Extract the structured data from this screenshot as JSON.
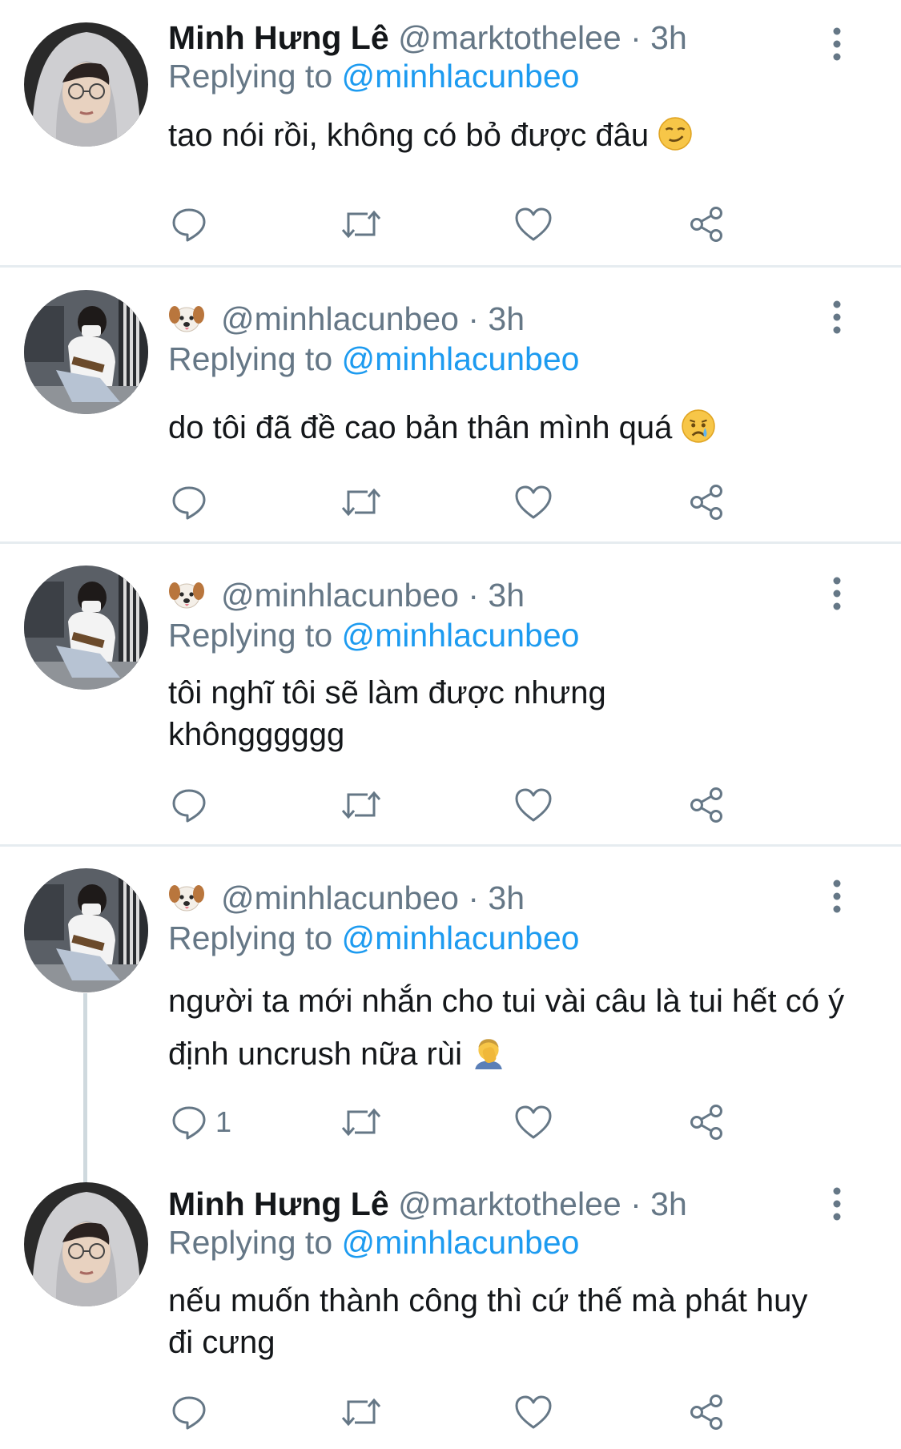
{
  "tweets": [
    {
      "display_name": "Minh Hưng Lê",
      "handle": "@marktothelee",
      "dot": "·",
      "time": "3h",
      "replying_label": "Replying to",
      "replying_handle": "@minhlacunbeo",
      "text": "tao nói rồi, không có bỏ được đâu",
      "emoji": "smirking-face",
      "reply_count": "",
      "avatar": "hooded-guy-glasses"
    },
    {
      "display_name_emoji": "dog-face",
      "handle": "@minhlacunbeo",
      "dot": "·",
      "time": "3h",
      "replying_label": "Replying to",
      "replying_handle": "@minhlacunbeo",
      "text": "do tôi đã đề cao bản thân mình quá",
      "emoji": "crying-face",
      "reply_count": "",
      "avatar": "guy-guitar"
    },
    {
      "display_name_emoji": "dog-face",
      "handle": "@minhlacunbeo",
      "dot": "·",
      "time": "3h",
      "replying_label": "Replying to",
      "replying_handle": "@minhlacunbeo",
      "text": "tôi nghĩ tôi sẽ làm được nhưng khôngggggg",
      "emoji": "",
      "reply_count": "",
      "avatar": "guy-guitar"
    },
    {
      "display_name_emoji": "dog-face",
      "handle": "@minhlacunbeo",
      "dot": "·",
      "time": "3h",
      "replying_label": "Replying to",
      "replying_handle": "@minhlacunbeo",
      "text": "người ta mới nhắn cho tui vài câu là tui hết có ý định uncrush nữa rùi",
      "emoji": "man-facepalming",
      "reply_count": "1",
      "avatar": "guy-guitar"
    },
    {
      "display_name": "Minh Hưng Lê",
      "handle": "@marktothelee",
      "dot": "·",
      "time": "3h",
      "replying_label": "Replying to",
      "replying_handle": "@minhlacunbeo",
      "text": "nếu muốn thành công thì cứ thế mà phát huy đi cưng",
      "emoji": "",
      "reply_count": "",
      "avatar": "hooded-guy-glasses"
    }
  ],
  "colors": {
    "link": "#1d9bf0",
    "secondary": "#657786",
    "divider": "#e6ecf0"
  },
  "icons": [
    "reply-icon",
    "retweet-icon",
    "like-icon",
    "share-icon",
    "more-icon"
  ]
}
